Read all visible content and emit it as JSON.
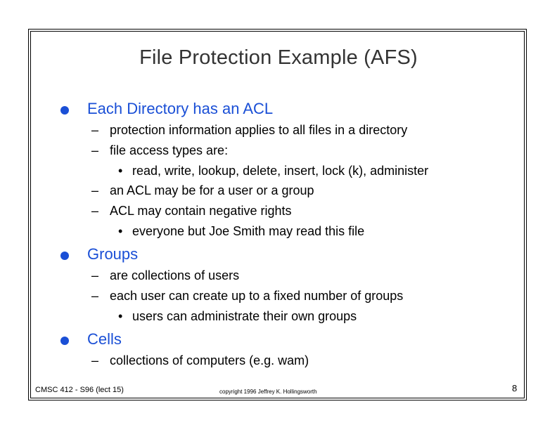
{
  "slide": {
    "title": "File Protection Example (AFS)",
    "sections": [
      {
        "heading": "Each Directory has an ACL",
        "items": [
          "protection information applies to all files in a directory",
          "file access types are:",
          "read, write, lookup, delete, insert, lock (k), administer",
          "an ACL may be for a user or a group",
          "ACL may contain negative rights",
          "everyone but Joe Smith may read this file"
        ]
      },
      {
        "heading": "Groups",
        "items": [
          "are collections of users",
          "each user can create up to a fixed number of groups",
          "users can administrate their own groups"
        ]
      },
      {
        "heading": "Cells",
        "items": [
          "collections of computers (e.g. wam)"
        ]
      }
    ],
    "footer": {
      "course": "CMSC 412 - S96  (lect 15)",
      "copyright": "copyright 1996 Jeffrey K. Hollingsworth",
      "page": "8"
    },
    "glyphs": {
      "dash": "–",
      "dot": "•"
    },
    "colors": {
      "heading": "#1a4fd6",
      "title": "#333333"
    }
  }
}
